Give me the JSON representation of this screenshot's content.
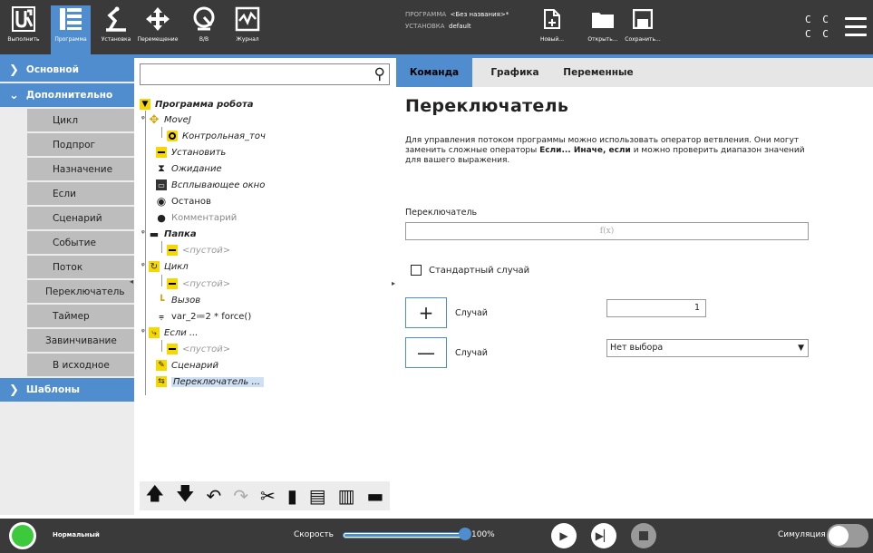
{
  "topbar": {
    "run_label": "Выполнить",
    "program_label": "Программа",
    "installation_label": "Установка",
    "move_label": "Перемещение",
    "io_label": "В/В",
    "log_label": "Журнал",
    "program_caption": "ПРОГРАММА",
    "program_name": "<Без названия>*",
    "installation_caption": "УСТАНОВКА",
    "installation_name": "default",
    "new_label": "Новый...",
    "open_label": "Открыть...",
    "save_label": "Сохранить...",
    "cc_line1": "C C",
    "cc_line2": "C C",
    "accent_color": "#4f8dcf"
  },
  "sidebar": {
    "basic": "Основной",
    "advanced": "Дополнительно",
    "items": [
      "Цикл",
      "Подпрог",
      "Назначение",
      "Если",
      "Сценарий",
      "Событие",
      "Поток",
      "Переключатель",
      "Таймер",
      "Завинчивание",
      "В исходное"
    ],
    "templates": "Шаблоны"
  },
  "tree": {
    "search_placeholder": "",
    "nodes": [
      {
        "text": "Программа робота"
      },
      {
        "text": "MoveJ"
      },
      {
        "text": "Контрольная_точ"
      },
      {
        "text": "Установить"
      },
      {
        "text": "Ожидание"
      },
      {
        "text": "Всплывающее окно"
      },
      {
        "text": "Останов"
      },
      {
        "text": "Комментарий"
      },
      {
        "text": "Папка"
      },
      {
        "text": "<пустой>"
      },
      {
        "text": "Цикл"
      },
      {
        "text": "<пустой>"
      },
      {
        "text": "Вызов"
      },
      {
        "text": "var_2≔2 * force()"
      },
      {
        "text": "Если ..."
      },
      {
        "text": "<пустой>"
      },
      {
        "text": "Сценарий"
      },
      {
        "text": "Переключатель ..."
      }
    ]
  },
  "main": {
    "tabs": [
      "Команда",
      "Графика",
      "Переменные"
    ],
    "title": "Переключатель",
    "desc_1": "Для управления потоком программы можно использовать оператор ветвления. Они могут заменить сложные операторы ",
    "desc_bold_1": "Если... Иначе, если",
    "desc_2": " и можно проверить диапазон значений для вашего выражения.",
    "switch_label": "Переключатель",
    "switch_expr_placeholder": "f(x)",
    "default_case_label": "Стандартный случай",
    "case1_label": "Случай",
    "case1_value": "1",
    "case2_label": "Случай",
    "case2_value": "Нет выбора"
  },
  "bottombar": {
    "status": "Нормальный",
    "status_color": "#3cc93c",
    "speed_label": "Скорость",
    "speed_value": "100%",
    "speed_fraction": 1.0,
    "sim_label": "Симуляция",
    "simulation_on": false
  }
}
